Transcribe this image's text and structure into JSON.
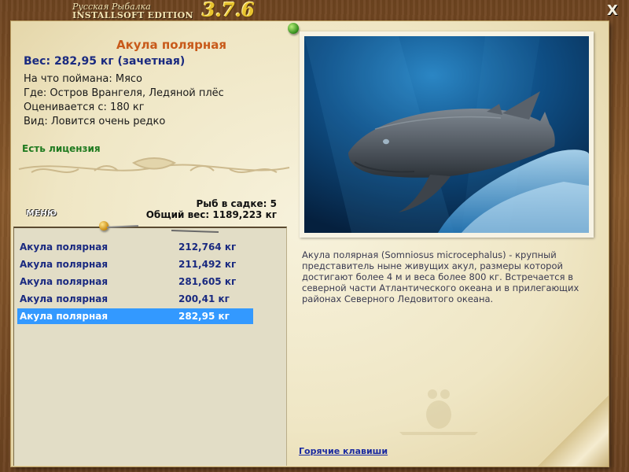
{
  "app": {
    "logo_line1": "Русская Рыбалка",
    "logo_line2": "INSTALLSOFT EDITION",
    "version": "3.7.6",
    "close_label": "X"
  },
  "fish": {
    "name": "Акула полярная",
    "weight_line": "Вес: 282,95 кг (зачетная)",
    "caught_on": "На что поймана: Мясо",
    "location": "Где: Остров Врангеля, Ледяной плёс",
    "valued_from": "Оценивается с: 180 кг",
    "rarity": "Вид: Ловится очень редко",
    "license": "Есть лицензия"
  },
  "keepnet": {
    "count_line": "Рыб в садке: 5",
    "total_line": "Общий вес: 1189,223 кг",
    "menu_label": "МЕНЮ",
    "rows": [
      {
        "name": "Акула полярная",
        "weight": "212,764 кг"
      },
      {
        "name": "Акула полярная",
        "weight": "211,492 кг"
      },
      {
        "name": "Акула полярная",
        "weight": "281,605 кг"
      },
      {
        "name": "Акула полярная",
        "weight": "200,41 кг"
      },
      {
        "name": "Акула полярная",
        "weight": "282,95 кг"
      }
    ],
    "selected_index": 4
  },
  "description": "Акула полярная (Somniosus microcephalus) - крупный представитель ныне живущих акул, размеры которой достигают более 4 м и веса более 800 кг. Встречается в северной части Атлантического океана и в прилегающих районах Северного Ледовитого океана.",
  "hotkeys_label": "Горячие клавиши",
  "colors": {
    "fish_name": "#c85a1a",
    "weight": "#1a2a80",
    "license": "#1f7a1f",
    "selection": "#3399ff",
    "hotkeys_link": "#1a2aa0"
  }
}
